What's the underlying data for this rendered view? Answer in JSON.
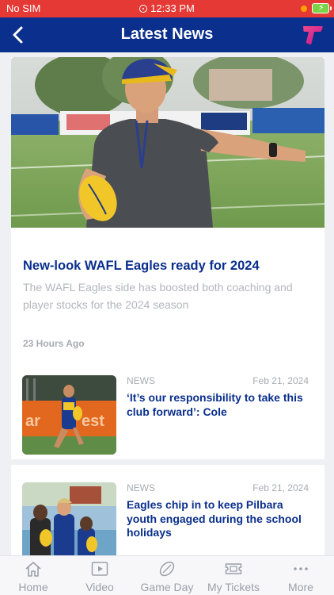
{
  "status_bar": {
    "carrier": "No SIM",
    "time": "12:33 PM"
  },
  "nav": {
    "title": "Latest News"
  },
  "featured": {
    "headline": "New-look WAFL Eagles ready for 2024",
    "summary": "The WAFL Eagles side has boosted both coaching and player stocks for the 2024 season",
    "time_ago": "23 Hours Ago"
  },
  "news": [
    {
      "category": "NEWS",
      "date": "Feb 21, 2024",
      "title": "‘It’s our responsibility to take this club forward’: Cole"
    },
    {
      "category": "NEWS",
      "date": "Feb 21, 2024",
      "title": "Eagles chip in to keep Pilbara youth engaged during the school holidays"
    }
  ],
  "tabs": [
    {
      "label": "Home",
      "icon": "home-icon"
    },
    {
      "label": "Video",
      "icon": "video-icon"
    },
    {
      "label": "Game Day",
      "icon": "football-icon"
    },
    {
      "label": "My Tickets",
      "icon": "ticket-icon"
    },
    {
      "label": "More",
      "icon": "more-icon"
    }
  ],
  "colors": {
    "status_bar": "#e53935",
    "nav_bar": "#0a2f8c",
    "headline": "#0a2f8c",
    "muted": "#a7abb2",
    "brand_logo": "#e4187a"
  }
}
